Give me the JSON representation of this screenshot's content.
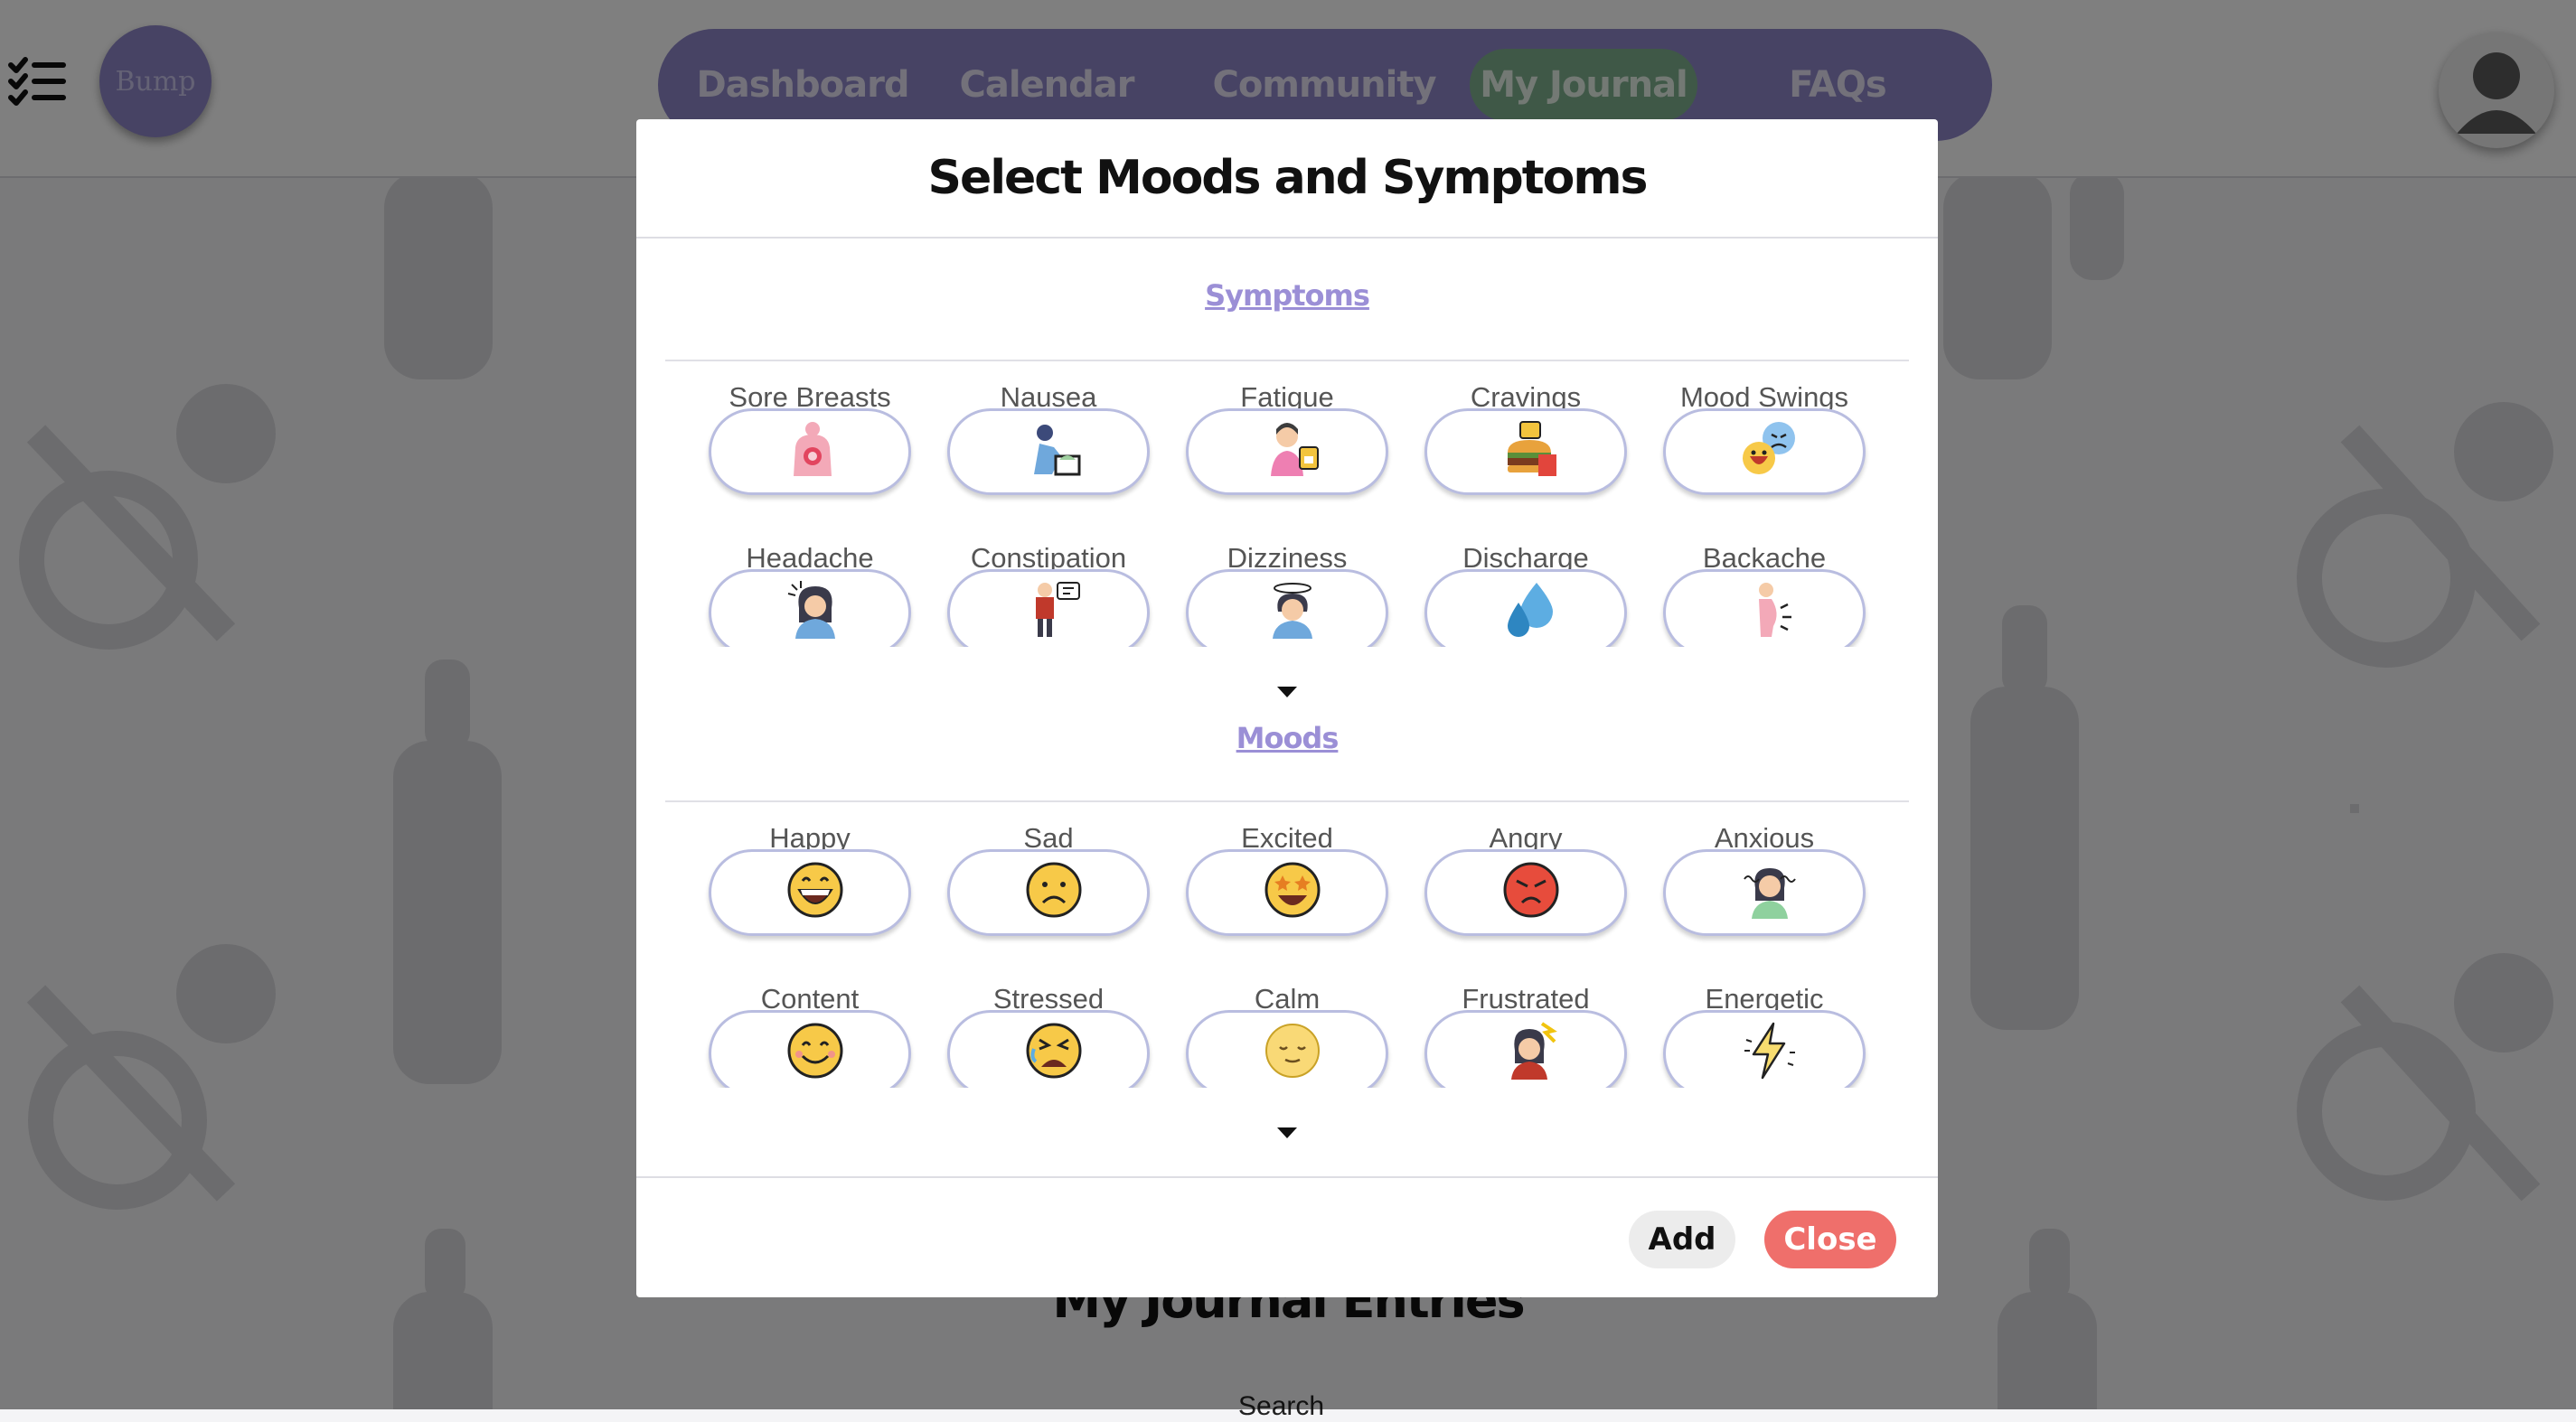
{
  "nav": {
    "logo_text": "Bump",
    "items": [
      {
        "label": "Dashboard"
      },
      {
        "label": "Calendar"
      },
      {
        "label": "Community"
      },
      {
        "label": "My Journal",
        "active": true
      },
      {
        "label": "FAQs"
      }
    ]
  },
  "page": {
    "entries_title": "My Journal Entries",
    "entries_subtitle": "Search"
  },
  "modal": {
    "title": "Select Moods and Symptoms",
    "symptoms": {
      "heading": "Symptoms",
      "items": [
        {
          "label": "Sore Breasts",
          "icon": "sore-breasts-icon"
        },
        {
          "label": "Nausea",
          "icon": "nausea-icon"
        },
        {
          "label": "Fatigue",
          "icon": "fatigue-icon"
        },
        {
          "label": "Cravings",
          "icon": "cravings-icon"
        },
        {
          "label": "Mood Swings",
          "icon": "mood-swings-icon"
        },
        {
          "label": "Headache",
          "icon": "headache-icon"
        },
        {
          "label": "Constipation",
          "icon": "constipation-icon"
        },
        {
          "label": "Dizziness",
          "icon": "dizziness-icon"
        },
        {
          "label": "Discharge",
          "icon": "discharge-icon"
        },
        {
          "label": "Backache",
          "icon": "backache-icon"
        }
      ]
    },
    "moods": {
      "heading": "Moods",
      "items": [
        {
          "label": "Happy",
          "icon": "happy-face-icon"
        },
        {
          "label": "Sad",
          "icon": "sad-face-icon"
        },
        {
          "label": "Excited",
          "icon": "excited-face-icon"
        },
        {
          "label": "Angry",
          "icon": "angry-face-icon"
        },
        {
          "label": "Anxious",
          "icon": "anxious-icon"
        },
        {
          "label": "Content",
          "icon": "content-face-icon"
        },
        {
          "label": "Stressed",
          "icon": "stressed-face-icon"
        },
        {
          "label": "Calm",
          "icon": "calm-face-icon"
        },
        {
          "label": "Frustrated",
          "icon": "frustrated-icon"
        },
        {
          "label": "Energetic",
          "icon": "energetic-bolt-icon"
        }
      ]
    },
    "add_label": "Add",
    "close_label": "Close"
  },
  "colors": {
    "nav_bg": "#8f86c9",
    "nav_active": "#7fb08f",
    "section_heading": "#9b8fd6",
    "pill_border": "#b9bde0",
    "close_button": "#ef6f6b"
  }
}
